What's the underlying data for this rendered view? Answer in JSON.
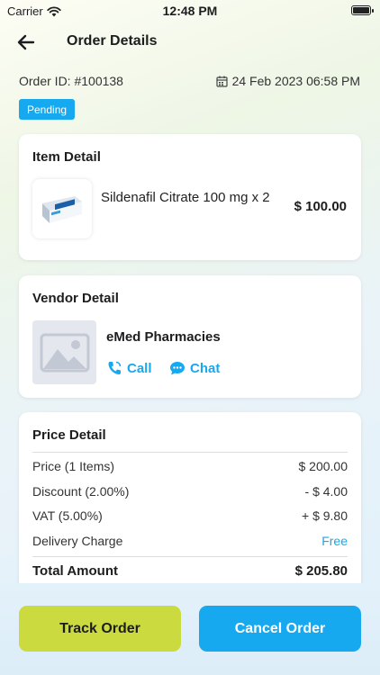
{
  "status_bar": {
    "carrier": "Carrier",
    "time": "12:48 PM"
  },
  "header": {
    "title": "Order Details",
    "back_icon": "arrow-left-icon"
  },
  "order": {
    "id_text": "Order ID: #100138",
    "date_text": "24 Feb 2023 06:58 PM",
    "status": "Pending",
    "status_color": "#16a9ef"
  },
  "item_detail": {
    "title": "Item Detail",
    "name": "Sildenafil Citrate 100 mg x 2",
    "price": "$ 100.00"
  },
  "vendor_detail": {
    "title": "Vendor Detail",
    "name": "eMed Pharmacies",
    "call_label": "Call",
    "chat_label": "Chat"
  },
  "price_detail": {
    "title": "Price Detail",
    "rows": [
      {
        "label": "Price (1 Items)",
        "value": "$ 200.00"
      },
      {
        "label": "Discount (2.00%)",
        "value": "- $ 4.00"
      },
      {
        "label": "VAT (5.00%)",
        "value": "+ $ 9.80"
      },
      {
        "label": "Delivery Charge",
        "value": "Free"
      }
    ],
    "total_label": "Total Amount",
    "total_value": "$ 205.80"
  },
  "actions": {
    "track_label": "Track Order",
    "cancel_label": "Cancel Order"
  },
  "colors": {
    "accent_blue": "#16a9ef",
    "accent_lime": "#cbdb3f"
  }
}
